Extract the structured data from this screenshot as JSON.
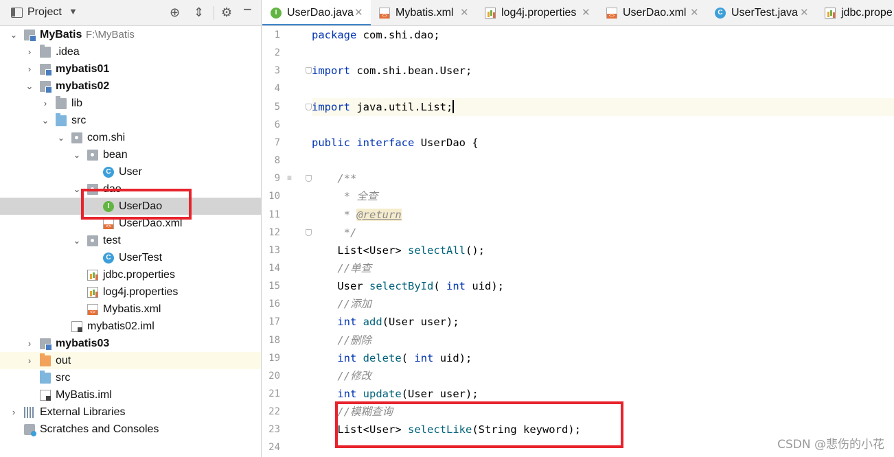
{
  "project_panel": {
    "title": "Project",
    "tree": [
      {
        "label": "MyBatis",
        "sub": "F:\\MyBatis",
        "bold": true,
        "depth": 0,
        "arrow": "open",
        "icon": "module-icon"
      },
      {
        "label": ".idea",
        "depth": 1,
        "arrow": "closed",
        "icon": "folder-icon"
      },
      {
        "label": "mybatis01",
        "bold": true,
        "depth": 1,
        "arrow": "closed",
        "icon": "module-icon"
      },
      {
        "label": "mybatis02",
        "bold": true,
        "depth": 1,
        "arrow": "open",
        "icon": "module-icon"
      },
      {
        "label": "lib",
        "depth": 2,
        "arrow": "closed",
        "icon": "folder-icon"
      },
      {
        "label": "src",
        "depth": 2,
        "arrow": "open",
        "icon": "source-folder-icon"
      },
      {
        "label": "com.shi",
        "depth": 3,
        "arrow": "open",
        "icon": "package-icon"
      },
      {
        "label": "bean",
        "depth": 4,
        "arrow": "open",
        "icon": "package-icon"
      },
      {
        "label": "User",
        "depth": 5,
        "arrow": "",
        "icon": "class-icon"
      },
      {
        "label": "dao",
        "depth": 4,
        "arrow": "open",
        "icon": "package-icon"
      },
      {
        "label": "UserDao",
        "depth": 5,
        "arrow": "",
        "icon": "interface-icon",
        "selected": true
      },
      {
        "label": "UserDao.xml",
        "depth": 5,
        "arrow": "",
        "icon": "xml-file-icon"
      },
      {
        "label": "test",
        "depth": 4,
        "arrow": "open",
        "icon": "package-icon"
      },
      {
        "label": "UserTest",
        "depth": 5,
        "arrow": "",
        "icon": "class-icon"
      },
      {
        "label": "jdbc.properties",
        "depth": 4,
        "arrow": "",
        "icon": "properties-file-icon"
      },
      {
        "label": "log4j.properties",
        "depth": 4,
        "arrow": "",
        "icon": "properties-file-icon"
      },
      {
        "label": "Mybatis.xml",
        "depth": 4,
        "arrow": "",
        "icon": "xml-file-icon"
      },
      {
        "label": "mybatis02.iml",
        "depth": 3,
        "arrow": "",
        "icon": "iml-file-icon"
      },
      {
        "label": "mybatis03",
        "bold": true,
        "depth": 1,
        "arrow": "closed",
        "icon": "module-icon"
      },
      {
        "label": "out",
        "depth": 1,
        "arrow": "closed",
        "icon": "excluded-folder-icon",
        "highlight": true
      },
      {
        "label": "src",
        "depth": 1,
        "arrow": "",
        "icon": "source-folder-icon"
      },
      {
        "label": "MyBatis.iml",
        "depth": 1,
        "arrow": "",
        "icon": "iml-file-icon"
      },
      {
        "label": "External Libraries",
        "depth": 0,
        "arrow": "closed",
        "icon": "libraries-icon"
      },
      {
        "label": "Scratches and Consoles",
        "depth": 0,
        "arrow": "",
        "icon": "scratches-icon"
      }
    ]
  },
  "tabs": [
    {
      "label": "UserDao.java",
      "icon": "interface-icon",
      "active": true
    },
    {
      "label": "Mybatis.xml",
      "icon": "xml-file-icon"
    },
    {
      "label": "log4j.properties",
      "icon": "properties-file-icon"
    },
    {
      "label": "UserDao.xml",
      "icon": "xml-file-icon"
    },
    {
      "label": "UserTest.java",
      "icon": "class-icon"
    },
    {
      "label": "jdbc.prope",
      "icon": "properties-file-icon"
    }
  ],
  "code": [
    {
      "n": "1",
      "t": [
        [
          "kw",
          "package"
        ],
        [
          "",
          "com.shi.dao;"
        ]
      ]
    },
    {
      "n": "2",
      "t": []
    },
    {
      "n": "3",
      "t": [
        [
          "kw",
          "import"
        ],
        [
          "",
          "com.shi.bean.User;"
        ]
      ]
    },
    {
      "n": "4",
      "t": []
    },
    {
      "n": "5",
      "t": [
        [
          "kw",
          "import"
        ],
        [
          "",
          "java.util.List;"
        ]
      ],
      "current": true
    },
    {
      "n": "6",
      "t": []
    },
    {
      "n": "7",
      "t": [
        [
          "kw",
          "public"
        ],
        [
          "kw",
          "interface"
        ],
        [
          "",
          "UserDao {"
        ]
      ]
    },
    {
      "n": "8",
      "t": []
    },
    {
      "n": "9",
      "t": [
        [
          "cm",
          "/**"
        ]
      ],
      "indent": 1
    },
    {
      "n": "10",
      "t": [
        [
          "cm",
          " *"
        ],
        [
          "cm",
          "全查"
        ]
      ],
      "indent": 1
    },
    {
      "n": "11",
      "t": [
        [
          "cm",
          " *"
        ],
        [
          "tag",
          "@return"
        ]
      ],
      "indent": 1
    },
    {
      "n": "12",
      "t": [
        [
          "cm",
          " */"
        ]
      ],
      "indent": 1
    },
    {
      "n": "13",
      "t": [
        [
          "",
          "List<User>"
        ],
        [
          "fn",
          "selectAll"
        ],
        [
          "",
          "();"
        ]
      ],
      "indent": 1
    },
    {
      "n": "14",
      "t": [
        [
          "cm",
          "//单查"
        ]
      ],
      "indent": 1
    },
    {
      "n": "15",
      "t": [
        [
          "",
          "User"
        ],
        [
          "fn",
          "selectById"
        ],
        [
          "",
          "("
        ],
        [
          "kw",
          "int"
        ],
        [
          "",
          "uid);"
        ]
      ],
      "indent": 1
    },
    {
      "n": "16",
      "t": [
        [
          "cm",
          "//添加"
        ]
      ],
      "indent": 1
    },
    {
      "n": "17",
      "t": [
        [
          "kw",
          "int"
        ],
        [
          "fn",
          "add"
        ],
        [
          "",
          "(User user);"
        ]
      ],
      "indent": 1
    },
    {
      "n": "18",
      "t": [
        [
          "cm",
          "//删除"
        ]
      ],
      "indent": 1
    },
    {
      "n": "19",
      "t": [
        [
          "kw",
          "int"
        ],
        [
          "fn",
          "delete"
        ],
        [
          "",
          "("
        ],
        [
          "kw",
          "int"
        ],
        [
          "",
          "uid);"
        ]
      ],
      "indent": 1
    },
    {
      "n": "20",
      "t": [
        [
          "cm",
          "//修改"
        ]
      ],
      "indent": 1
    },
    {
      "n": "21",
      "t": [
        [
          "kw",
          "int"
        ],
        [
          "fn",
          "update"
        ],
        [
          "",
          "(User user);"
        ]
      ],
      "indent": 1
    },
    {
      "n": "22",
      "t": [
        [
          "cm",
          "//模糊查询"
        ]
      ],
      "indent": 1
    },
    {
      "n": "23",
      "t": [
        [
          "",
          "List<User>"
        ],
        [
          "fn",
          "selectLike"
        ],
        [
          "",
          "(String keyword);"
        ]
      ],
      "indent": 1
    },
    {
      "n": "24",
      "t": []
    }
  ],
  "watermark": "CSDN @悲伤的小花",
  "colors": {
    "keyword": "#0033b3",
    "method": "#00627a",
    "comment": "#8c8c8c",
    "highlight_box": "#e8232c"
  }
}
